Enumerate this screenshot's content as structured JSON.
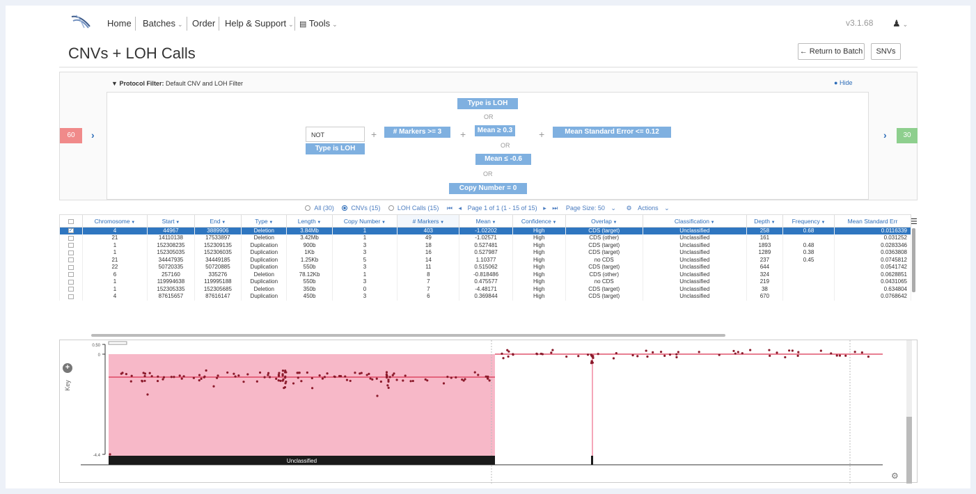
{
  "nav": {
    "home": "Home",
    "batches": "Batches",
    "order": "Order",
    "help": "Help & Support",
    "tools": "Tools",
    "version": "v3.1.68"
  },
  "page": {
    "title": "CNVs + LOH Calls",
    "return_button": "← Return to Batch",
    "snvs_button": "SNVs"
  },
  "filter": {
    "label_bold": "Protocol Filter:",
    "label_value": "Default CNV and LOH Filter",
    "hide": "Hide",
    "left_count": "60",
    "right_count": "30",
    "not_text": "NOT",
    "chips": {
      "type_loh_top": "Type is LOH",
      "type_loh_not": "Type is LOH",
      "markers": "# Markers >= 3",
      "mean_gte": "Mean ≥ 0.3",
      "mean_lte": "Mean ≤ -0.6",
      "copy_zero": "Copy Number = 0",
      "mse": "Mean Standard Error <= 0.12"
    },
    "or": "OR",
    "plus": "+"
  },
  "pager": {
    "all": "All (30)",
    "cnvs": "CNVs (15)",
    "loh": "LOH Calls (15)",
    "first": "⏮",
    "prev": "◂",
    "page_info": "Page 1 of 1 (1 - 15 of 15)",
    "next": "▸",
    "last": "⏭",
    "page_size": "Page Size: 50",
    "actions": "Actions"
  },
  "table": {
    "headers": [
      "Chromosome",
      "Start",
      "End",
      "Type",
      "Length",
      "Copy Number",
      "# Markers",
      "Mean",
      "Confidence",
      "Overlap",
      "Classification",
      "Depth",
      "Frequency",
      "Mean Standard Err"
    ],
    "rows": [
      [
        "4",
        "44967",
        "3889906",
        "Deletion",
        "3.84Mb",
        "1",
        "403",
        "-1.02202",
        "High",
        "CDS (target)",
        "Unclassified",
        "258",
        "0.68",
        "0.0116339"
      ],
      [
        "21",
        "14110138",
        "17533897",
        "Deletion",
        "3.42Mb",
        "1",
        "49",
        "-1.02571",
        "High",
        "CDS (other)",
        "Unclassified",
        "161",
        "",
        "0.031252"
      ],
      [
        "1",
        "152308235",
        "152309135",
        "Duplication",
        "900b",
        "3",
        "18",
        "0.527481",
        "High",
        "CDS (target)",
        "Unclassified",
        "1893",
        "0.48",
        "0.0283346"
      ],
      [
        "1",
        "152305035",
        "152306035",
        "Duplication",
        "1Kb",
        "3",
        "16",
        "0.527987",
        "High",
        "CDS (target)",
        "Unclassified",
        "1289",
        "0.38",
        "0.0363808"
      ],
      [
        "21",
        "34447935",
        "34449185",
        "Duplication",
        "1.25Kb",
        "5",
        "14",
        "1.10377",
        "High",
        "no CDS",
        "Unclassified",
        "237",
        "0.45",
        "0.0745812"
      ],
      [
        "22",
        "50720335",
        "50720885",
        "Duplication",
        "550b",
        "3",
        "11",
        "0.515062",
        "High",
        "CDS (target)",
        "Unclassified",
        "644",
        "",
        "0.0541742"
      ],
      [
        "6",
        "257160",
        "335276",
        "Deletion",
        "78.12Kb",
        "1",
        "8",
        "-0.818486",
        "High",
        "CDS (other)",
        "Unclassified",
        "324",
        "",
        "0.0628851"
      ],
      [
        "1",
        "119994638",
        "119995188",
        "Duplication",
        "550b",
        "3",
        "7",
        "0.475577",
        "High",
        "no CDS",
        "Unclassified",
        "219",
        "",
        "0.0431065"
      ],
      [
        "1",
        "152305335",
        "152305685",
        "Deletion",
        "350b",
        "0",
        "7",
        "-4.48171",
        "High",
        "CDS (target)",
        "Unclassified",
        "38",
        "",
        "0.634804"
      ],
      [
        "4",
        "87615657",
        "87616147",
        "Duplication",
        "450b",
        "3",
        "6",
        "0.369844",
        "High",
        "CDS (target)",
        "Unclassified",
        "670",
        "",
        "0.0768642"
      ]
    ]
  },
  "plot": {
    "y_top_label": "0.50",
    "y_zero_label": "0",
    "y_bottom_label": "-4.4",
    "region_label": "Unclassified",
    "key_label": "Key",
    "colors": {
      "region": "#f7b8c8",
      "line": "#d9304f",
      "dot": "#8b1a2b",
      "bar": "#1a1a1a"
    }
  }
}
